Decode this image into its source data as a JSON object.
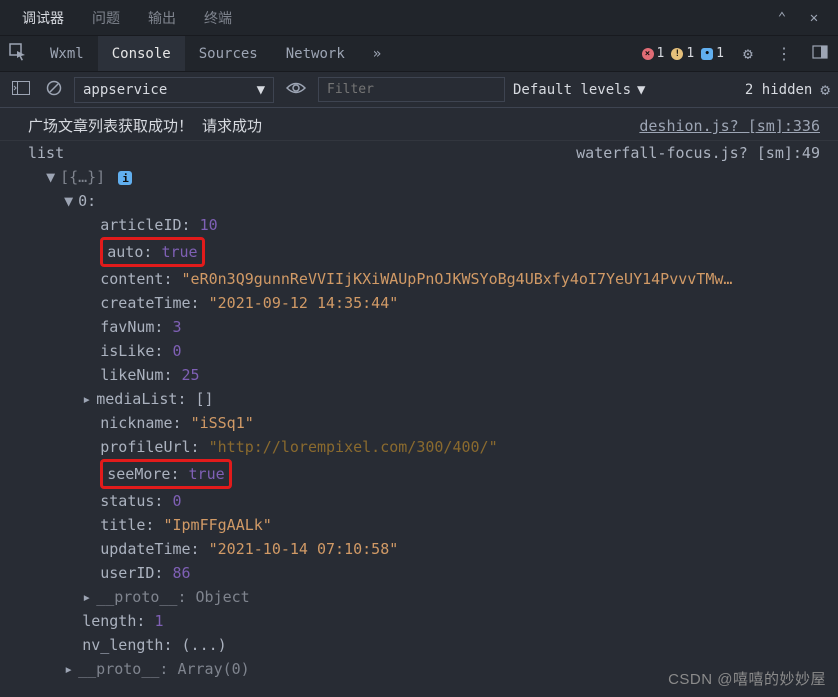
{
  "topTabs": {
    "items": [
      "调试器",
      "问题",
      "输出",
      "终端"
    ],
    "activeIndex": 0
  },
  "panelTabs": {
    "items": [
      "Wxml",
      "Console",
      "Sources",
      "Network"
    ],
    "activeIndex": 1,
    "overflow": "»",
    "errors": "1",
    "warnings": "1",
    "infos": "1"
  },
  "toolbar": {
    "context": "appservice",
    "filterPlaceholder": "Filter",
    "levels": "Default levels",
    "hidden": "2 hidden"
  },
  "messages": [
    {
      "text": "广场文章列表获取成功！ 请求成功",
      "source": "deshion.js? [sm]:336"
    }
  ],
  "object": {
    "header": "list",
    "source": "waterfall-focus.js? [sm]:49",
    "preview": "[{…}]",
    "indexLabel": "0:",
    "props": {
      "articleID": 10,
      "auto": "true",
      "content": "\"eR0n3Q9gunnReVVIIjKXiWAUpPnOJKWSYoBg4UBxfy4oI7YeUY14PvvvTMw…",
      "createTime": "\"2021-09-12 14:35:44\"",
      "favNum": 3,
      "isLike": 0,
      "likeNum": 25,
      "mediaList": "[]",
      "nickname": "\"iSSq1\"",
      "profileUrl": "\"http://lorempixel.com/300/400/\"",
      "seeMore": "true",
      "status": 0,
      "title": "\"IpmFFgAALk\"",
      "updateTime": "\"2021-10-14 07:10:58\"",
      "userID": 86
    },
    "proto0": "__proto__: Object",
    "length": "1",
    "nv_length": "(...)",
    "protoArr": "__proto__: Array(0)"
  },
  "watermark": "CSDN @嘻嘻的妙妙屋"
}
